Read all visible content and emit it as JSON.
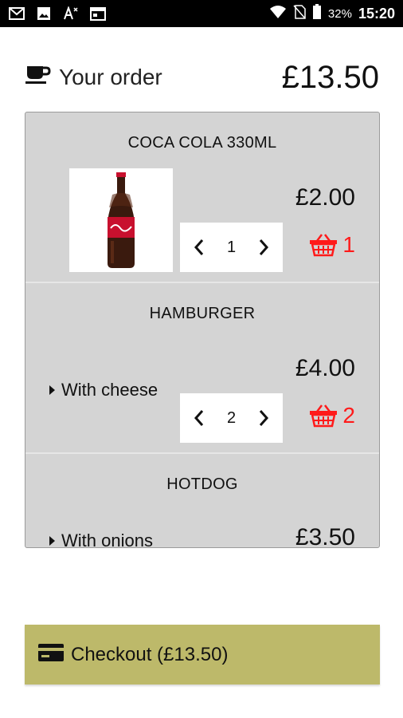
{
  "status_bar": {
    "icons": [
      "gmail-icon",
      "image-icon",
      "text-size-icon",
      "calendar-icon"
    ],
    "battery_percent": "32%",
    "time": "15:20"
  },
  "header": {
    "title": "Your order",
    "total": "£13.50",
    "icon": "coffee-cup-icon"
  },
  "items": [
    {
      "title": "COCA COLA 330ML",
      "price": "£2.00",
      "quantity": "1",
      "basket_count": "1",
      "image": "coca-cola-bottle"
    },
    {
      "title": "HAMBURGER",
      "option": "With cheese",
      "price": "£4.00",
      "quantity": "2",
      "basket_count": "2"
    },
    {
      "title": "HOTDOG",
      "option": "With onions",
      "price": "£3.50"
    }
  ],
  "checkout": {
    "label": "Checkout (£13.50)",
    "icon": "credit-card-icon",
    "color": "#bdb96a"
  },
  "colors": {
    "basket": "#ff1a1a",
    "panel": "#d4d4d4"
  }
}
